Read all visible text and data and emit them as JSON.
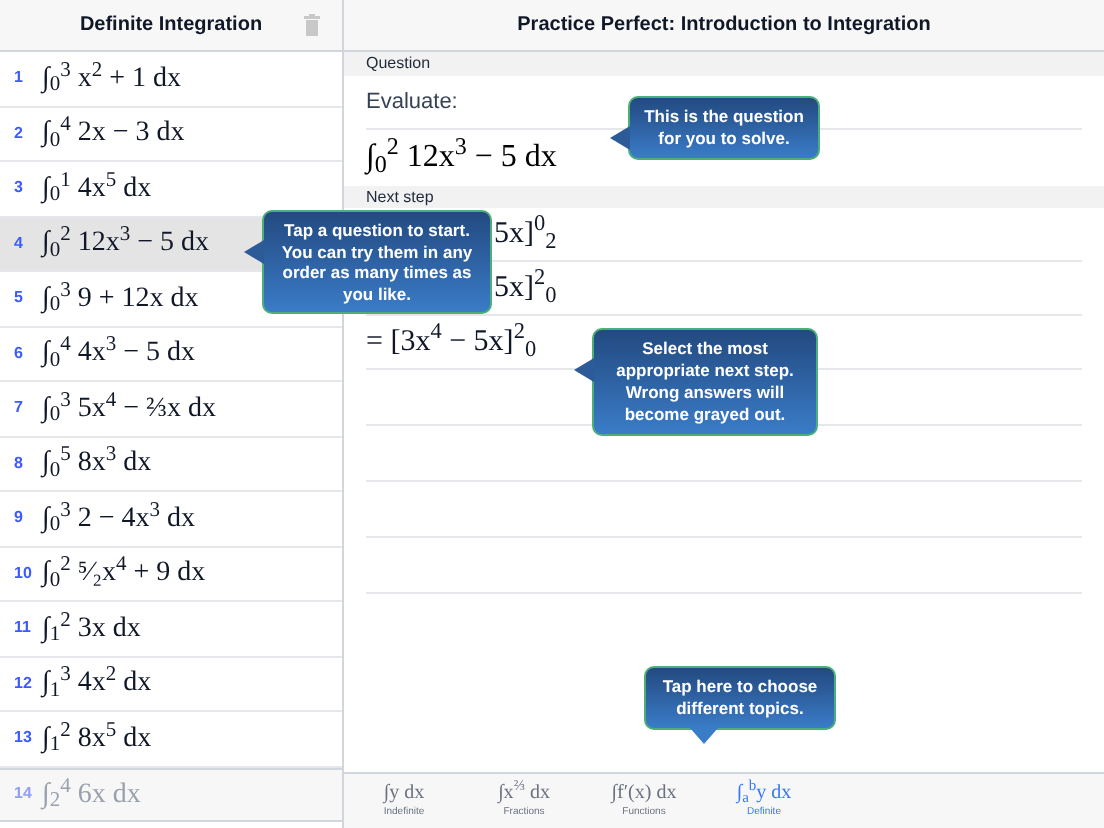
{
  "sidebar": {
    "title": "Definite Integration",
    "questions": [
      {
        "number": "1",
        "expression": "∫$_{0}$$^{3}$ x$^{2}$ + 1 dx",
        "selected": false
      },
      {
        "number": "2",
        "expression": "∫$_{0}$$^{4}$ 2x − 3 dx",
        "selected": false
      },
      {
        "number": "3",
        "expression": "∫$_{0}$$^{1}$ 4x$^{5}$ dx",
        "selected": false
      },
      {
        "number": "4",
        "expression": "∫$_{0}$$^{2}$ 12x$^{3}$ − 5 dx",
        "selected": true
      },
      {
        "number": "5",
        "expression": "∫$_{0}$$^{3}$ 9 + 12x dx",
        "selected": false
      },
      {
        "number": "6",
        "expression": "∫$_{0}$$^{4}$ 4x$^{3}$ − 5 dx",
        "selected": false
      },
      {
        "number": "7",
        "expression": "∫$_{0}$$^{3}$ 5x$^{4}$ − ⅔x dx",
        "selected": false
      },
      {
        "number": "8",
        "expression": "∫$_{0}$$^{5}$ 8x$^{3}$ dx",
        "selected": false
      },
      {
        "number": "9",
        "expression": "∫$_{0}$$^{3}$ 2 − 4x$^{3}$ dx",
        "selected": false
      },
      {
        "number": "10",
        "expression": "∫$_{0}$$^{2}$ ⁵⁄₂x$^{4}$ + 9 dx",
        "selected": false
      },
      {
        "number": "11",
        "expression": "∫$_{1}$$^{2}$ 3x dx",
        "selected": false
      },
      {
        "number": "12",
        "expression": "∫$_{1}$$^{3}$ 4x$^{2}$ dx",
        "selected": false
      },
      {
        "number": "13",
        "expression": "∫$_{1}$$^{2}$ 8x$^{5}$ dx",
        "selected": false
      },
      {
        "number": "14",
        "expression": "∫$_{2}$$^{4}$ 6x dx",
        "selected": false
      }
    ]
  },
  "main": {
    "title": "Practice Perfect: Introduction to Integration",
    "question": {
      "header": "Question",
      "prompt": "Evaluate:",
      "expression": "∫$_{0}$$^{2}$ 12x$^{3}$ − 5 dx"
    },
    "next_step": {
      "header": "Next step",
      "options": [
        {
          "text": "5x]$^{0}$$_{2}$",
          "covered": true
        },
        {
          "text": "5x]$^{2}$$_{0}$",
          "covered": true
        },
        {
          "text": "= [3x$^{4}$ − 5x]$^{2}$$_{0}$",
          "covered": false
        }
      ]
    }
  },
  "tooltips": [
    {
      "text": "Tap a question to start. You can try them in any order as many times as you like."
    },
    {
      "text": "This is the question for you to solve."
    },
    {
      "text": "Select the most appropriate next step. Wrong answers will become grayed out."
    },
    {
      "text": "Tap here to choose different topics."
    }
  ],
  "tab_bar": {
    "tabs": [
      {
        "icon": "∫y dx",
        "label": "Indefinite",
        "selected": false
      },
      {
        "icon": "∫x$^{⅔}$ dx",
        "label": "Fractions",
        "selected": false
      },
      {
        "icon": "∫f′(x) dx",
        "label": "Functions",
        "selected": false
      },
      {
        "icon": "∫$_{a}$$^{b}$y dx",
        "label": "Definite",
        "selected": true
      }
    ]
  }
}
